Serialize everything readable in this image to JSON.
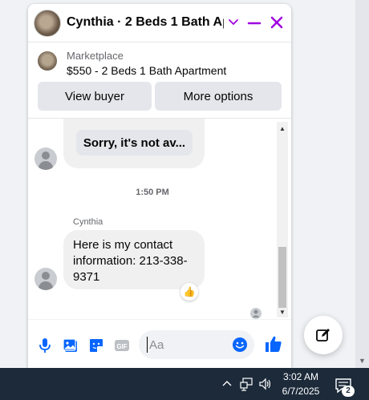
{
  "chat": {
    "title": "Cynthia · 2 Beds 1 Bath Ap...",
    "icons": {
      "minimize": "minimize-icon",
      "close": "close-icon",
      "chevron": "chevron-down-icon"
    },
    "accent_color": "#a000e0"
  },
  "listing": {
    "source": "Marketplace",
    "price_title": "$550 - 2 Beds 1 Bath Apartment",
    "view_buyer_label": "View buyer",
    "more_options_label": "More options"
  },
  "conversation": {
    "prior_reply": "Sorry, it's not av...",
    "timestamp": "1:50 PM",
    "sender": "Cynthia",
    "message": "Here is my contact information: 213-338-9371",
    "reaction": "👍"
  },
  "composer": {
    "placeholder": "Aa",
    "like_color": "#0866ff",
    "icons": [
      "microphone-icon",
      "photo-icon",
      "sticker-icon",
      "gif-icon",
      "emoji-icon",
      "thumbs-up-icon"
    ]
  },
  "taskbar": {
    "time": "3:02 AM",
    "date": "6/7/2025",
    "notification_count": "2"
  }
}
